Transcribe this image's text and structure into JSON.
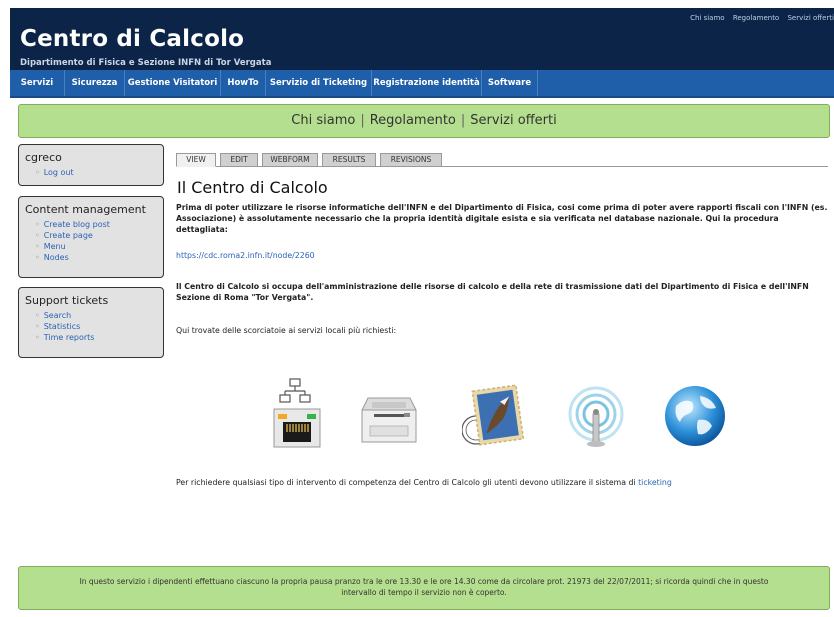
{
  "header": {
    "title": "Centro di Calcolo",
    "subtitle": "Dipartimento di Fisica e Sezione INFN di Tor Vergata",
    "top_links": [
      "Chi siamo",
      "Regolamento",
      "Servizi offerti"
    ]
  },
  "nav": {
    "items": [
      "Servizi",
      "Sicurezza",
      "Gestione Visitatori",
      "HowTo",
      "Servizio di Ticketing",
      "Registrazione identità",
      "Software"
    ]
  },
  "greenbar": {
    "links": [
      "Chi siamo",
      "Regolamento",
      "Servizi offerti"
    ],
    "separator": "|"
  },
  "sidebar": {
    "user": {
      "title": "cgreco",
      "items": [
        "Log out"
      ]
    },
    "content": {
      "title": "Content management",
      "items": [
        "Create blog post",
        "Create page",
        "Menu",
        "Nodes"
      ]
    },
    "support": {
      "title": "Support tickets",
      "items": [
        "Search",
        "Statistics",
        "Time reports"
      ]
    }
  },
  "tabs": [
    "VIEW",
    "EDIT",
    "WEBFORM",
    "RESULTS",
    "REVISIONS"
  ],
  "main": {
    "title": "Il Centro di Calcolo",
    "p1": "Prima di poter utilizzare le risorse informatiche dell'INFN e del Dipartimento di Fisica, cosi come prima di poter avere rapporti fiscali con l'INFN (es. Associazione) è assolutamente necessario che la propria identità digitale esista e sia verificata nel database nazionale. Qui la procedura dettagliata:",
    "url": "https://cdc.roma2.infn.it/node/2260",
    "p2": "Il Centro di Calcolo si occupa dell'amministrazione delle risorse di calcolo e della rete di trasmissione dati del Dipartimento di Fisica e dell'INFN Sezione di Roma \"Tor Vergata\".",
    "p3": "Qui trovate delle scorciatoie ai servizi locali più richiesti:",
    "p4_prefix": "Per richiedere qualsiasi tipo di intervento di competenza del Centro di Calcolo gli utenti devono utilizzare il sistema di ",
    "p4_link": "ticketing"
  },
  "icons": [
    "network-icon",
    "printer-icon",
    "mail-icon",
    "wifi-icon",
    "globe-icon"
  ],
  "footer": {
    "line1": "In questo servizio i dipendenti effettuano ciascuno la propria pausa pranzo tra le ore 13.30 e le ore 14.30 come da circolare prot. 21973 del 22/07/2011; si ricorda quindi che in questo",
    "line2": "intervallo di tempo il servizio non è coperto."
  },
  "colors": {
    "header_bg": "#0b2447",
    "nav_bg": "#1f5ea8",
    "green_bar": "#b4df8f",
    "link": "#2a63b5"
  }
}
